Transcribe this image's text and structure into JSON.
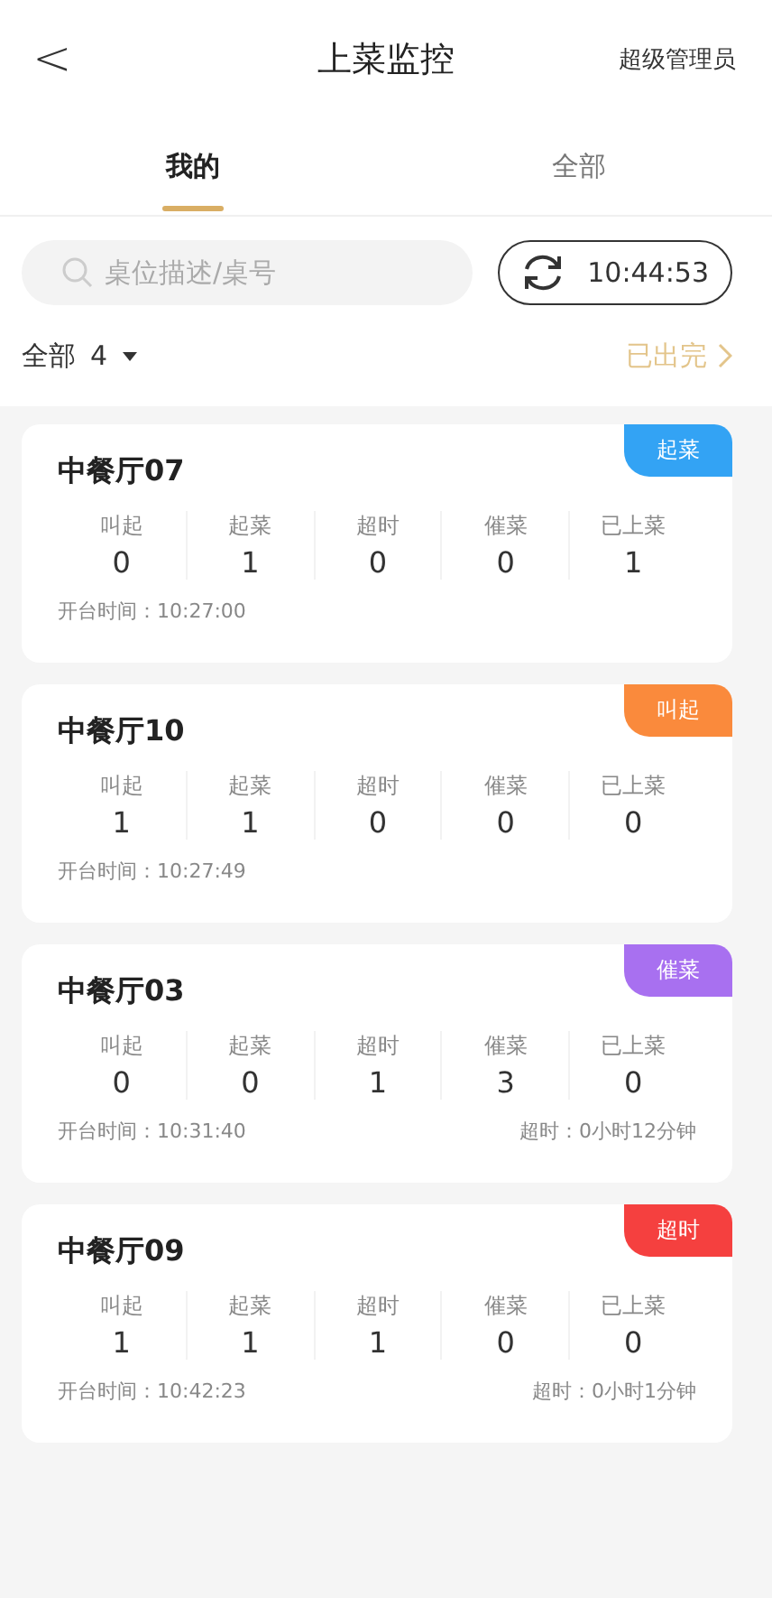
{
  "header": {
    "back": "<",
    "title": "上菜监控",
    "user": "超级管理员"
  },
  "tabs": [
    {
      "label": "我的",
      "selected": true
    },
    {
      "label": "全部",
      "selected": false
    }
  ],
  "search": {
    "placeholder": "桌位描述/桌号"
  },
  "refresh": {
    "time": "10:44:53"
  },
  "filter": {
    "label": "全部",
    "count": "4",
    "finished": "已出完"
  },
  "cards": [
    {
      "name": "中餐厅07",
      "badge": "起菜",
      "color": "#33a3f4",
      "stats": [
        {
          "label": "叫起",
          "value": "0"
        },
        {
          "label": "起菜",
          "value": "1"
        },
        {
          "label": "超时",
          "value": "0"
        },
        {
          "label": "催菜",
          "value": "0"
        },
        {
          "label": "已上菜",
          "value": "1"
        }
      ],
      "open_time": "开台时间：10:27:00"
    },
    {
      "name": "中餐厅10",
      "badge": "叫起",
      "color": "#fa8a3c",
      "stats": [
        {
          "label": "叫起",
          "value": "1"
        },
        {
          "label": "起菜",
          "value": "1"
        },
        {
          "label": "超时",
          "value": "0"
        },
        {
          "label": "催菜",
          "value": "0"
        },
        {
          "label": "已上菜",
          "value": "0"
        }
      ],
      "open_time": "开台时间：10:27:49"
    },
    {
      "name": "中餐厅03",
      "badge": "催菜",
      "color": "#a870f0",
      "stats": [
        {
          "label": "叫起",
          "value": "0"
        },
        {
          "label": "起菜",
          "value": "0"
        },
        {
          "label": "超时",
          "value": "1"
        },
        {
          "label": "催菜",
          "value": "3"
        },
        {
          "label": "已上菜",
          "value": "0"
        }
      ],
      "open_time": "开台时间：10:31:40",
      "overtime": "超时：0小时12分钟"
    },
    {
      "name": "中餐厅09",
      "badge": "超时",
      "color": "#f5403f",
      "stats": [
        {
          "label": "叫起",
          "value": "1"
        },
        {
          "label": "起菜",
          "value": "1"
        },
        {
          "label": "超时",
          "value": "1"
        },
        {
          "label": "催菜",
          "value": "0"
        },
        {
          "label": "已上菜",
          "value": "0"
        }
      ],
      "open_time": "开台时间：10:42:23",
      "overtime": "超时：0小时1分钟"
    }
  ]
}
